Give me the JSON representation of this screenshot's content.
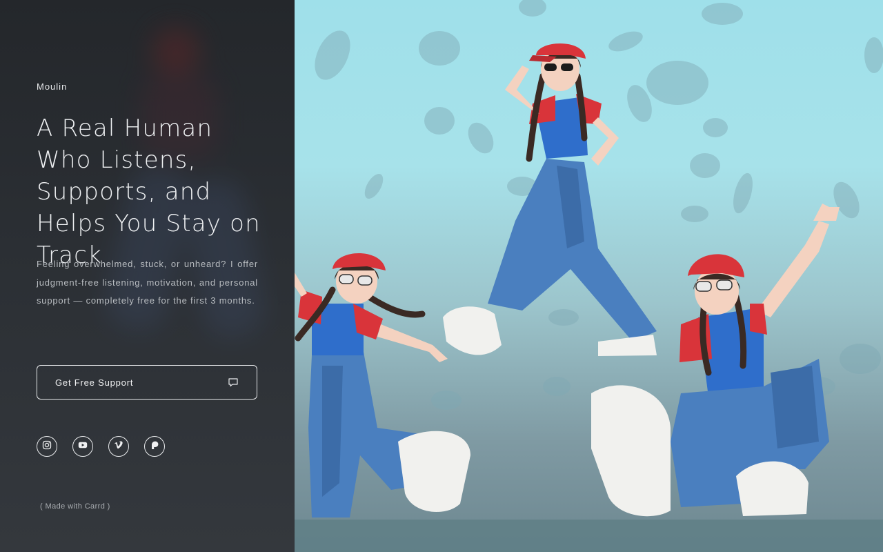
{
  "brand": "Moulin",
  "headline": "A Real Human Who Listens, Supports, and Helps You Stay on Track",
  "lede": "Feeling overwhelmed, stuck, or unheard? I offer judgment-free listening, motivation, and personal support — completely free for the first 3 months.",
  "cta": {
    "label": "Get Free Support",
    "icon": "chat-bubble-icon"
  },
  "socials": [
    {
      "name": "instagram",
      "icon": "instagram-icon"
    },
    {
      "name": "youtube",
      "icon": "youtube-icon"
    },
    {
      "name": "vimeo",
      "icon": "vimeo-icon"
    },
    {
      "name": "patreon",
      "icon": "patreon-icon"
    }
  ],
  "credit": "( Made with Carrd )",
  "colors": {
    "panel": "#2a2d31",
    "sky": "#9fe0ea",
    "cap_red": "#d9343a",
    "denim": "#4a7fbf"
  }
}
